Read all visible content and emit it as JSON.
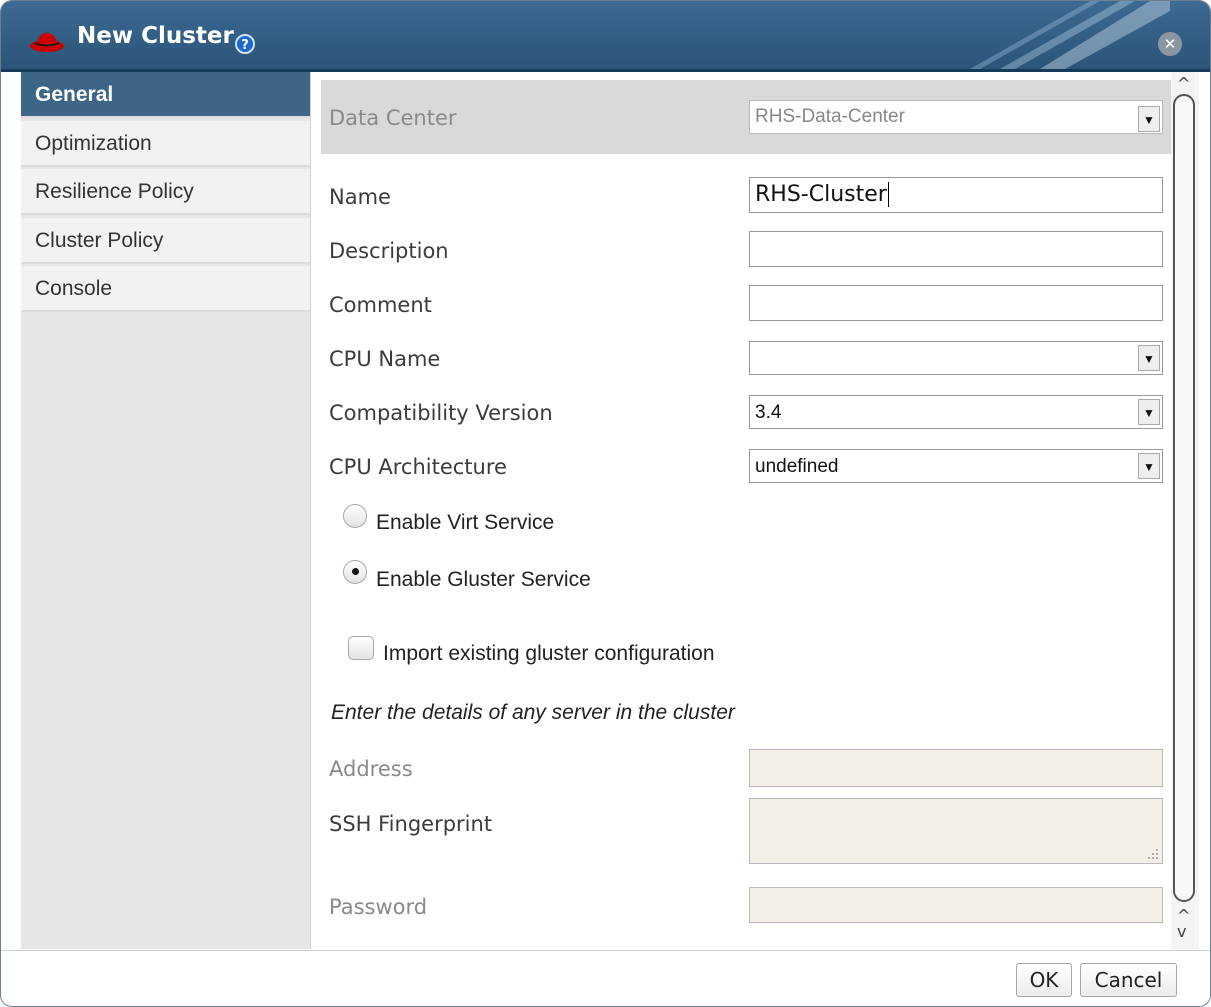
{
  "window": {
    "title": "New Cluster",
    "help_icon": "?",
    "close_icon": "✕"
  },
  "sidebar": {
    "items": [
      {
        "label": "General",
        "active": true
      },
      {
        "label": "Optimization",
        "active": false
      },
      {
        "label": "Resilience Policy",
        "active": false
      },
      {
        "label": "Cluster Policy",
        "active": false
      },
      {
        "label": "Console",
        "active": false
      }
    ]
  },
  "form": {
    "data_center": {
      "label": "Data Center",
      "value": "RHS-Data-Center"
    },
    "name": {
      "label": "Name",
      "value": "RHS-Cluster"
    },
    "description": {
      "label": "Description",
      "value": ""
    },
    "comment": {
      "label": "Comment",
      "value": ""
    },
    "cpu_name": {
      "label": "CPU Name",
      "value": ""
    },
    "compat_version": {
      "label": "Compatibility Version",
      "value": "3.4"
    },
    "cpu_arch": {
      "label": "CPU Architecture",
      "value": "undefined"
    },
    "virt_service": {
      "label": "Enable Virt Service",
      "selected": false
    },
    "gluster_service": {
      "label": "Enable Gluster Service",
      "selected": true
    },
    "import_gluster": {
      "label": "Import existing gluster configuration",
      "checked": false
    },
    "server_note": "Enter the details of any server in the cluster",
    "address": {
      "label": "Address",
      "value": ""
    },
    "ssh_fingerprint": {
      "label": "SSH Fingerprint",
      "value": ""
    },
    "password": {
      "label": "Password",
      "value": ""
    }
  },
  "footer": {
    "ok_label": "OK",
    "cancel_label": "Cancel"
  },
  "icons": {
    "dropdown_arrow": "▼",
    "scroll_up": "^",
    "scroll_down": "v"
  },
  "colors": {
    "titlebar": "#2b5478",
    "active_nav": "#3c6587",
    "help": "#1b6ac9",
    "logo": "#cc0000"
  }
}
